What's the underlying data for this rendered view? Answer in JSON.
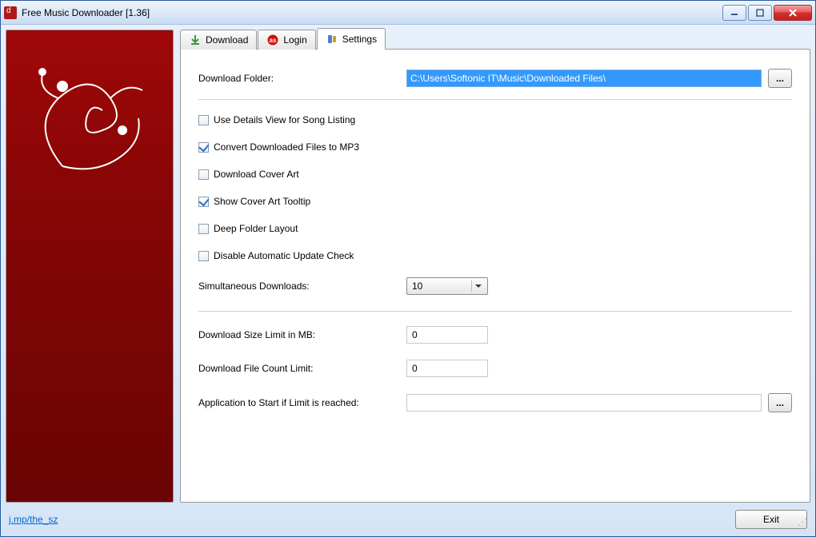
{
  "window": {
    "title": "Free Music Downloader [1.36]"
  },
  "tabs": {
    "download": "Download",
    "login": "Login",
    "settings": "Settings"
  },
  "settings": {
    "download_folder_label": "Download Folder:",
    "download_folder_value": "C:\\Users\\Softonic IT\\Music\\Downloaded Files\\",
    "browse_label": "...",
    "checkboxes": {
      "details_view": {
        "label": "Use Details View for Song Listing",
        "checked": false
      },
      "convert_mp3": {
        "label": "Convert Downloaded Files to MP3",
        "checked": true
      },
      "cover_art": {
        "label": "Download Cover Art",
        "checked": false
      },
      "cover_tooltip": {
        "label": "Show Cover Art Tooltip",
        "checked": true
      },
      "deep_folder": {
        "label": "Deep Folder Layout",
        "checked": false
      },
      "disable_update": {
        "label": "Disable Automatic Update Check",
        "checked": false
      }
    },
    "simultaneous_label": "Simultaneous Downloads:",
    "simultaneous_value": "10",
    "size_limit_label": "Download Size Limit in MB:",
    "size_limit_value": "0",
    "count_limit_label": "Download File Count Limit:",
    "count_limit_value": "0",
    "app_limit_label": "Application to Start if Limit is reached:",
    "app_limit_value": "",
    "app_browse_label": "..."
  },
  "footer": {
    "link": "j.mp/the_sz",
    "exit": "Exit"
  }
}
